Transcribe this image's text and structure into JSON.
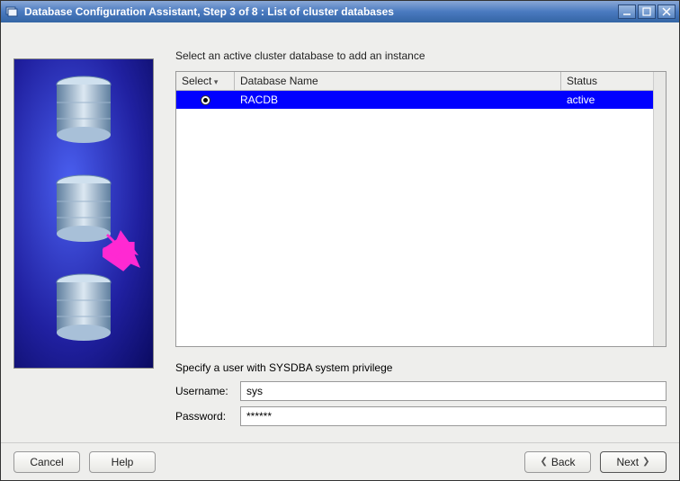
{
  "window": {
    "title": "Database Configuration Assistant, Step 3 of 8 : List of cluster databases"
  },
  "instruction": "Select an active cluster database to add an instance",
  "table": {
    "headers": {
      "select": "Select",
      "name": "Database Name",
      "status": "Status"
    },
    "rows": [
      {
        "selected": true,
        "name": "RACDB",
        "status": "active"
      }
    ]
  },
  "credentials": {
    "prompt": "Specify a user with SYSDBA system privilege",
    "username_label": "Username:",
    "username_value": "sys",
    "password_label": "Password:",
    "password_value": "******"
  },
  "buttons": {
    "cancel": "Cancel",
    "help": "Help",
    "back": "Back",
    "next": "Next"
  }
}
